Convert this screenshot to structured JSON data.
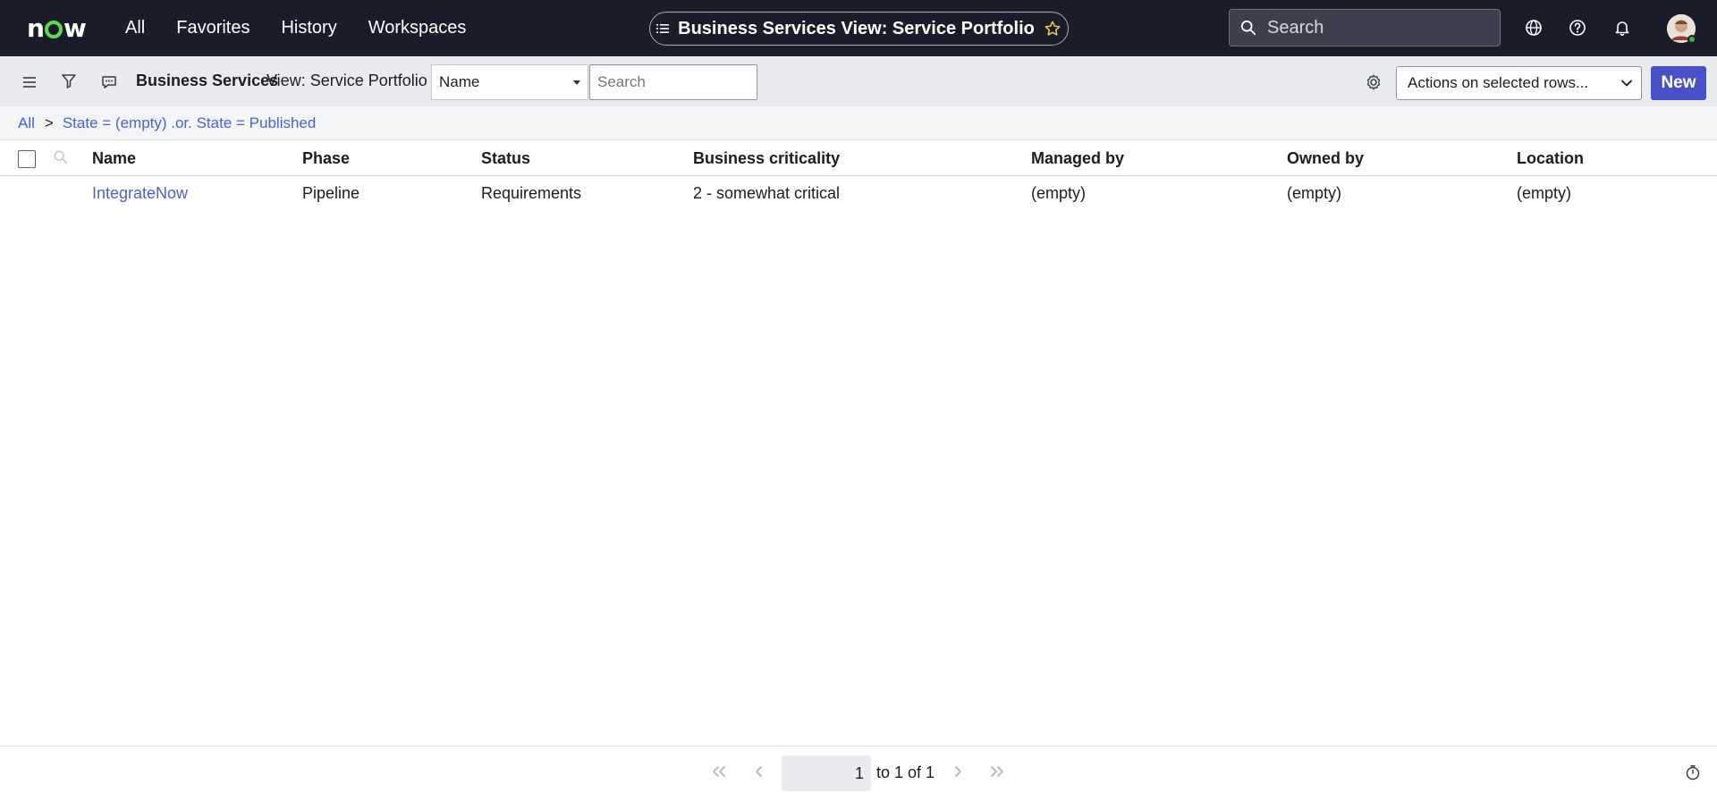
{
  "topnav": {
    "logo_text": "now",
    "links": [
      "All",
      "Favorites",
      "History",
      "Workspaces"
    ],
    "context_title": "Business Services View: Service Portfolio",
    "search_placeholder": "Search",
    "icons": [
      "globe-icon",
      "help-icon",
      "bell-icon"
    ]
  },
  "toolbar": {
    "title": "Business Services",
    "view_label": "View: Service Portfolio",
    "field_select_value": "Name",
    "search_placeholder": "Search",
    "actions_value": "Actions on selected rows...",
    "new_label": "New"
  },
  "breadcrumb": {
    "root": "All",
    "separator": ">",
    "filter": "State = (empty) .or. State = Published"
  },
  "table": {
    "columns": [
      "Name",
      "Phase",
      "Status",
      "Business criticality",
      "Managed by",
      "Owned by",
      "Location"
    ],
    "rows": [
      [
        "IntegrateNow",
        "Pipeline",
        "Requirements",
        "2 - somewhat critical",
        "(empty)",
        "(empty)",
        "(empty)"
      ]
    ]
  },
  "pagination": {
    "current_page": "1",
    "range_text": "to 1 of 1"
  },
  "colors": {
    "nav_bg": "#1a1d29",
    "accent": "#4a51c8",
    "link": "#4a62cf"
  }
}
